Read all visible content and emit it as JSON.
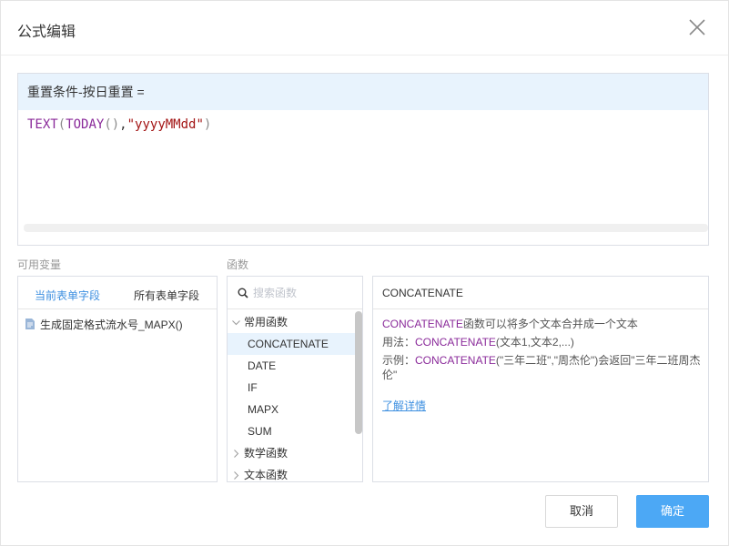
{
  "dialog": {
    "title": "公式编辑"
  },
  "editor": {
    "header": "重置条件-按日重置 =",
    "code": {
      "fn_text": "TEXT",
      "open1": "(",
      "fn_today": "TODAY",
      "parens": "()",
      "comma": ",",
      "str": "\"yyyyMMdd\"",
      "close1": ")"
    }
  },
  "variables": {
    "label": "可用变量",
    "tabs": [
      "当前表单字段",
      "所有表单字段"
    ],
    "active_tab": "当前表单字段",
    "items": [
      "生成固定格式流水号_MAPX()"
    ]
  },
  "functions": {
    "label": "函数",
    "search_placeholder": "搜索函数",
    "categories": [
      {
        "name": "常用函数",
        "expanded": true,
        "items": [
          "CONCATENATE",
          "DATE",
          "IF",
          "MAPX",
          "SUM"
        ]
      },
      {
        "name": "数学函数",
        "expanded": false
      },
      {
        "name": "文本函数",
        "expanded": false
      }
    ],
    "selected": "CONCATENATE"
  },
  "description": {
    "title": "CONCATENATE",
    "summary_fn": "CONCATENATE",
    "summary_rest": "函数可以将多个文本合并成一个文本",
    "usage_prefix": "用法：",
    "usage_fn": "CONCATENATE",
    "usage_rest": "(文本1,文本2,...)",
    "example_prefix": "示例：",
    "example_fn": "CONCATENATE",
    "example_rest": "(\"三年二班\",\"周杰伦\")会返回\"三年二班周杰伦\"",
    "link": "了解详情"
  },
  "buttons": {
    "cancel": "取消",
    "ok": "确定"
  },
  "colors": {
    "accent": "#4ca8f5",
    "link": "#3d8fe0",
    "function_highlight": "#8a2a9a",
    "string": "#a31515",
    "header_bg": "#e8f3fd"
  },
  "icons": [
    "close-icon",
    "document-icon",
    "search-icon",
    "chevron-down-icon",
    "chevron-right-icon"
  ]
}
